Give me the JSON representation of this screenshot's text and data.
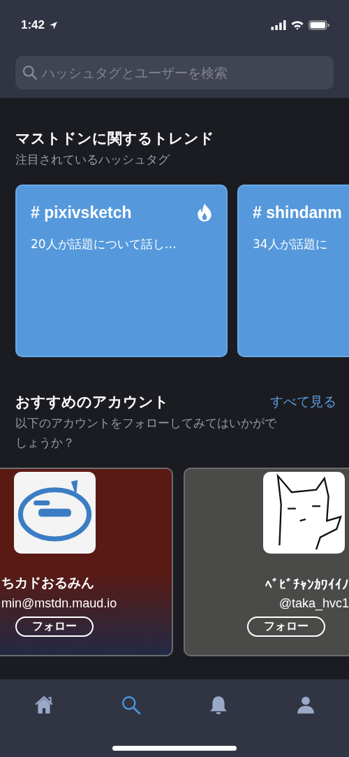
{
  "status_bar": {
    "time": "1:42"
  },
  "search": {
    "placeholder": "ハッシュタグとユーザーを検索"
  },
  "trends": {
    "title": "マストドンに関するトレンド",
    "subtitle": "注目されているハッシュタグ",
    "cards": [
      {
        "hashtag": "# pixivsketch",
        "summary": "20人が話題について話し…",
        "hot": true
      },
      {
        "hashtag": "# shindanm",
        "summary": "34人が話題に"
      }
    ]
  },
  "suggestions": {
    "title": "おすすめのアカウント",
    "see_all": "すべて見る",
    "subtitle": "以下のアカウントをフォローしてみてはいかがでしょうか？",
    "accounts": [
      {
        "name": "ちカドおるみん",
        "handle": "min@mstdn.maud.io",
        "follow": "フォロー",
        "color": "#5a1a14"
      },
      {
        "name": "ﾍﾞﾋﾞﾁｬﾝｶﾜｲｲﾉ",
        "handle": "@taka_hvc1",
        "follow": "フォロー",
        "color": "#4a4a48"
      }
    ]
  },
  "tabs": [
    {
      "kind": "home",
      "selected": false
    },
    {
      "kind": "search",
      "selected": true
    },
    {
      "kind": "bell",
      "selected": false
    },
    {
      "kind": "person",
      "selected": false
    }
  ]
}
